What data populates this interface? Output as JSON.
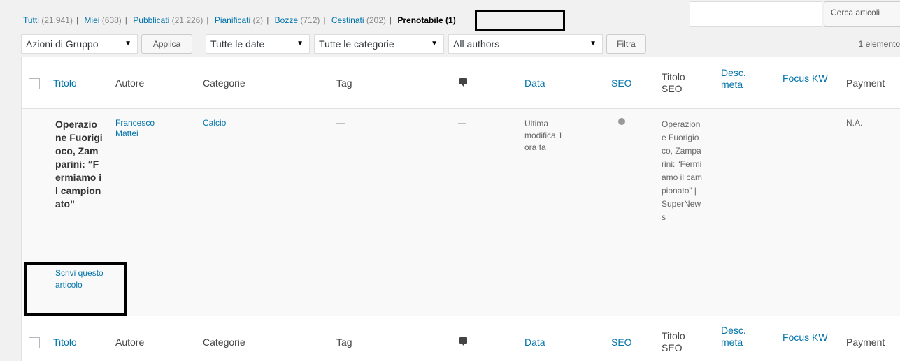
{
  "status_links": [
    {
      "label": "Tutti",
      "count": "(21.941)"
    },
    {
      "label": "Miei",
      "count": "(638)"
    },
    {
      "label": "Pubblicati",
      "count": "(21.226)"
    },
    {
      "label": "Pianificati",
      "count": "(2)"
    },
    {
      "label": "Bozze",
      "count": "(712)"
    },
    {
      "label": "Cestinati",
      "count": "(202)"
    },
    {
      "label": "Prenotabile (1)",
      "count": ""
    }
  ],
  "search": {
    "button_label": "Cerca articoli"
  },
  "tablenav": {
    "bulk_actions": "Azioni di Gruppo",
    "apply": "Applica",
    "dates": "Tutte le date",
    "categories": "Tutte le categorie",
    "authors": "All authors",
    "filter": "Filtra",
    "items_count": "1 elemento"
  },
  "columns": {
    "title": "Titolo",
    "author": "Autore",
    "categories": "Categorie",
    "tags": "Tag",
    "date": "Data",
    "seo": "SEO",
    "seo_title": "Titolo SEO",
    "meta_desc": "Desc. meta",
    "focus_kw": "Focus KW",
    "payment": "Payment"
  },
  "row": {
    "title": "Operazione Fuorigioco, Zamparini: “Fermiamo il campionato”",
    "action": "Scrivi questo articolo",
    "author": "Francesco Mattei",
    "category": "Calcio",
    "tags": "—",
    "comments": "—",
    "date": "Ultima modifica 1 ora fa",
    "seo_title": "Operazione Fuorigioco, Zamparini: “Fermiamo il campionato” | SuperNews",
    "payment": "N.A."
  },
  "colors": {
    "link": "#0073aa",
    "seo_dot": "#999999"
  }
}
